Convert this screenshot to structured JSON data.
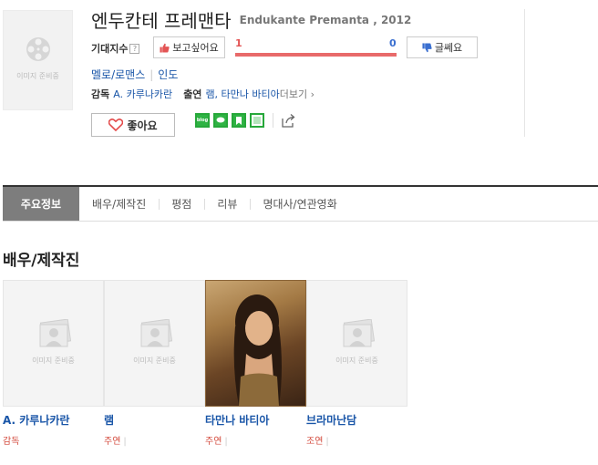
{
  "poster": {
    "placeholder": "이미지 준비중"
  },
  "title": {
    "korean": "엔두칸테 프레맨타",
    "english": "Endukante Premanta , 2012"
  },
  "expectation": {
    "label": "기대지수",
    "help": "?",
    "want_label": "보고싶어요",
    "no_label": "글쎄요",
    "want_count": "1",
    "no_count": "0",
    "want_ratio": 1.0
  },
  "genre": "멜로/로맨스",
  "country": "인도",
  "credits": {
    "director_label": "감독",
    "director": "A. 카루나카란",
    "cast_label": "출연",
    "cast": "램, 타만나 바티아",
    "more_label": "더보기 ›"
  },
  "like_label": "좋아요",
  "share": [
    {
      "icon": "blog-share-icon",
      "text": "blog"
    },
    {
      "icon": "chat-share-icon",
      "text": ""
    },
    {
      "icon": "bookmark-share-icon",
      "text": ""
    },
    {
      "icon": "square-share-icon",
      "text": ""
    }
  ],
  "tabs": [
    {
      "label": "주요정보",
      "active": true
    },
    {
      "label": "배우/제작진",
      "active": false
    },
    {
      "label": "평점",
      "active": false
    },
    {
      "label": "리뷰",
      "active": false
    },
    {
      "label": "명대사/연관영화",
      "active": false
    }
  ],
  "section_title": "배우/제작진",
  "cast_list": [
    {
      "name": "A. 카루나카란",
      "role": "감독",
      "photo": false,
      "placeholder": "이미지 준비중"
    },
    {
      "name": "램",
      "role": "주연",
      "photo": false,
      "placeholder": "이미지 준비중"
    },
    {
      "name": "타만나 바티아",
      "role": "주연",
      "photo": true,
      "placeholder": ""
    },
    {
      "name": "브라마난담",
      "role": "조연",
      "photo": false,
      "placeholder": "이미지 준비중"
    }
  ],
  "colors": {
    "link": "#1a56a8",
    "want": "#e35454",
    "no": "#3a6fd0",
    "share": "#2fb344",
    "tab_active": "#7d7d7d"
  }
}
